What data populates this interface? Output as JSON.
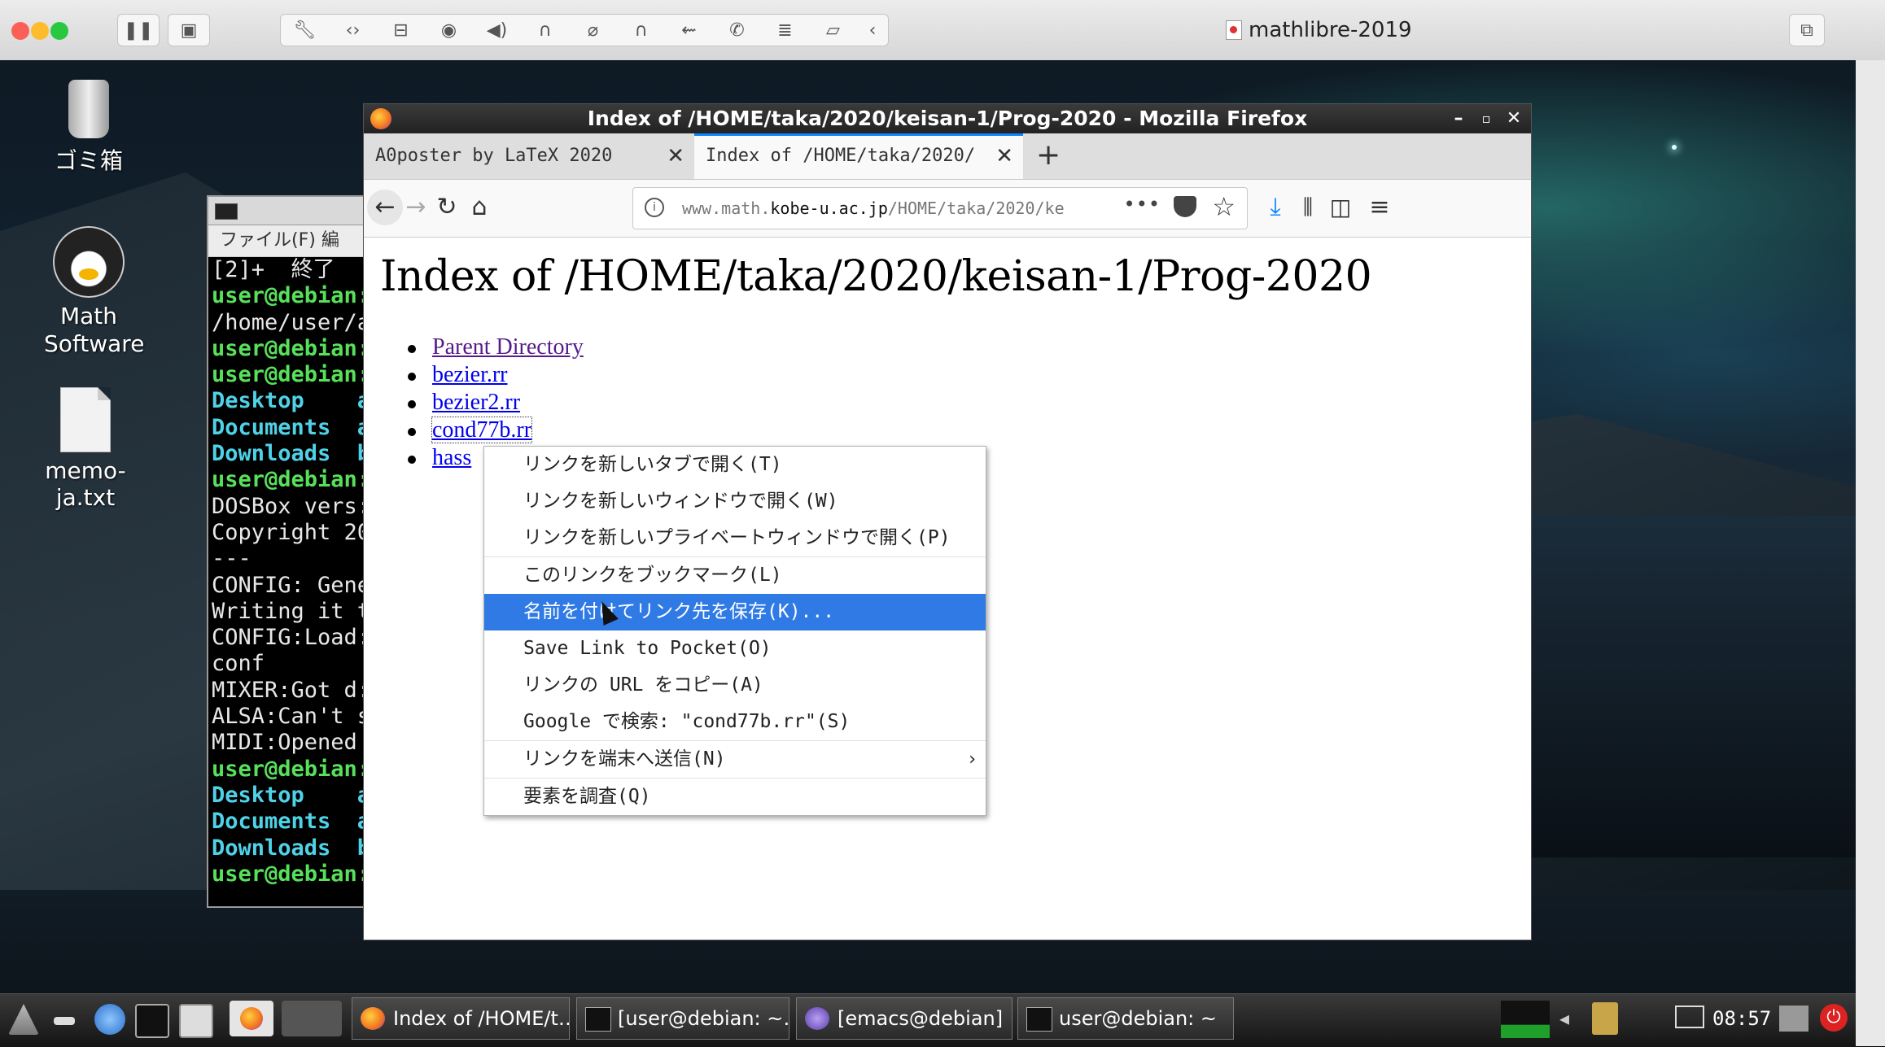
{
  "host": {
    "title": "mathlibre-2019",
    "toolbar_icons": [
      "pause-icon",
      "snapshot-icon",
      "wrench-icon",
      "code-icon",
      "hdd-icon",
      "webcam-icon",
      "speaker-icon",
      "headphones-icon",
      "mouse-icon",
      "headphones-icon",
      "usb-icon",
      "phone-icon",
      "list-icon",
      "folder-share-icon",
      "chevron-left-icon"
    ]
  },
  "desktop": {
    "icons": [
      {
        "label": "ゴミ箱"
      },
      {
        "label": "Math Software"
      },
      {
        "label": "memo-ja.txt"
      }
    ]
  },
  "terminal": {
    "menu": "ファイル(F)  編",
    "lines": [
      {
        "text": "[2]+  終了",
        "color": "white"
      },
      {
        "text": "user@debian:",
        "color": "green"
      },
      {
        "text": "/home/user/a",
        "color": "white"
      },
      {
        "text": "user@debian:",
        "color": "green"
      },
      {
        "text": "user@debian:",
        "color": "green"
      },
      {
        "text": "Desktop    a",
        "color": "cyan"
      },
      {
        "text": "Documents  a",
        "color": "cyan"
      },
      {
        "text": "Downloads  b",
        "color": "cyan"
      },
      {
        "text": "user@debian:",
        "color": "green"
      },
      {
        "text": "DOSBox vers:",
        "color": "white"
      },
      {
        "text": "Copyright 20",
        "color": "white"
      },
      {
        "text": "---",
        "color": "white"
      },
      {
        "text": "CONFIG: Gene",
        "color": "white"
      },
      {
        "text": "Writing it t",
        "color": "white"
      },
      {
        "text": "CONFIG:Load:",
        "color": "white"
      },
      {
        "text": "conf",
        "color": "white"
      },
      {
        "text": "MIXER:Got d:",
        "color": "white"
      },
      {
        "text": "ALSA:Can't s",
        "color": "white"
      },
      {
        "text": "MIDI:Opened",
        "color": "white"
      },
      {
        "text": "user@debian:",
        "color": "green"
      },
      {
        "text": "Desktop    a",
        "color": "cyan"
      },
      {
        "text": "Documents  a",
        "color": "cyan"
      },
      {
        "text": "Downloads  b",
        "color": "cyan"
      },
      {
        "text": "user@debian:",
        "color": "green"
      }
    ]
  },
  "firefox": {
    "window_title": "Index of /HOME/taka/2020/keisan-1/Prog-2020 - Mozilla Firefox",
    "tabs": [
      {
        "label": "A0poster by LaTeX 2020"
      },
      {
        "label": "Index of /HOME/taka/2020/ke"
      }
    ],
    "url": {
      "prefix": "www.math.",
      "domain": "kobe-u.ac.jp",
      "path": "/HOME/taka/2020/ke"
    },
    "url_more": "•••",
    "page": {
      "heading": "Index of /HOME/taka/2020/keisan-1/Prog-2020",
      "links": [
        "Parent Directory",
        "bezier.rr",
        "bezier2.rr",
        "cond77b.rr",
        "hass"
      ]
    }
  },
  "context_menu": {
    "items": [
      {
        "label": "リンクを新しいタブで開く(T)"
      },
      {
        "label": "リンクを新しいウィンドウで開く(W)"
      },
      {
        "label": "リンクを新しいプライベートウィンドウで開く(P)"
      },
      {
        "label": "このリンクをブックマーク(L)"
      },
      {
        "label": "名前を付けてリンク先を保存(K)..."
      },
      {
        "label": "Save Link to Pocket(O)"
      },
      {
        "label": "リンクの URL をコピー(A)"
      },
      {
        "label": "Google で検索: \"cond77b.rr\"(S)"
      },
      {
        "label": "リンクを端末へ送信(N)"
      },
      {
        "label": "要素を調査(Q)"
      }
    ],
    "highlighted_index": 4
  },
  "taskbar": {
    "tasks": [
      {
        "label": "Index of /HOME/t…"
      },
      {
        "label": "[user@debian: ~…"
      },
      {
        "label": "[emacs@debian]"
      },
      {
        "label": "user@debian: ~"
      }
    ],
    "clock": "08:57"
  },
  "colors": {
    "highlight": "#2f7ae5",
    "link": "#0000ee",
    "visited": "#551a8b",
    "term_green": "#58e05a",
    "term_cyan": "#4fd2e8"
  }
}
